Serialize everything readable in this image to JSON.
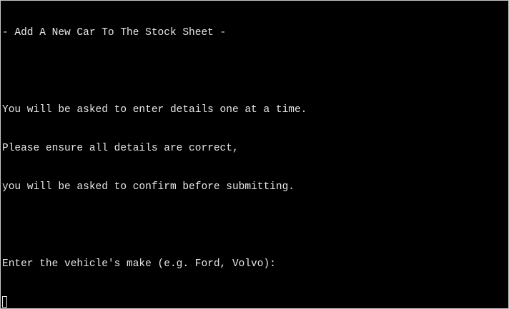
{
  "terminal": {
    "header": "- Add A New Car To The Stock Sheet -",
    "blank": "",
    "intro_line_1": "You will be asked to enter details one at a time.",
    "intro_line_2": "Please ensure all details are correct,",
    "intro_line_3": "you will be asked to confirm before submitting.",
    "prompt": "Enter the vehicle's make (e.g. Ford, Volvo):",
    "input_value": ""
  },
  "colors": {
    "background": "#000000",
    "text": "#e8e8e8"
  }
}
